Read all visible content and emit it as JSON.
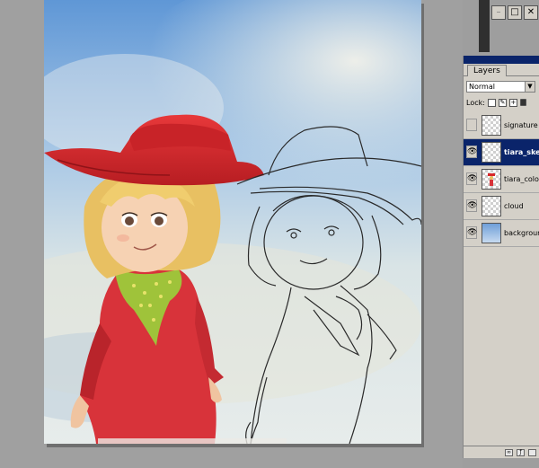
{
  "palette": {
    "tab_label": "Layers",
    "blend_mode": "Normal",
    "lock_label": "Lock:"
  },
  "window_controls": [
    "–",
    "□",
    "✕"
  ],
  "layers": [
    {
      "name": "signature",
      "visible": false,
      "selected": false,
      "thumb": "transparent"
    },
    {
      "name": "tiara_sket",
      "visible": true,
      "selected": true,
      "thumb": "transparent"
    },
    {
      "name": "tiara_colour",
      "visible": true,
      "selected": false,
      "thumb": "figure"
    },
    {
      "name": "cloud",
      "visible": true,
      "selected": false,
      "thumb": "transparent"
    },
    {
      "name": "backgroun",
      "visible": true,
      "selected": false,
      "thumb": "sky"
    }
  ],
  "colors": {
    "selection": "#0a246a",
    "hat_red": "#d8272a",
    "dress_red": "#d8333a",
    "scarf_green": "#9fc33a",
    "hair_blond": "#e8c062",
    "sky_blue": "#6c9fd9"
  }
}
